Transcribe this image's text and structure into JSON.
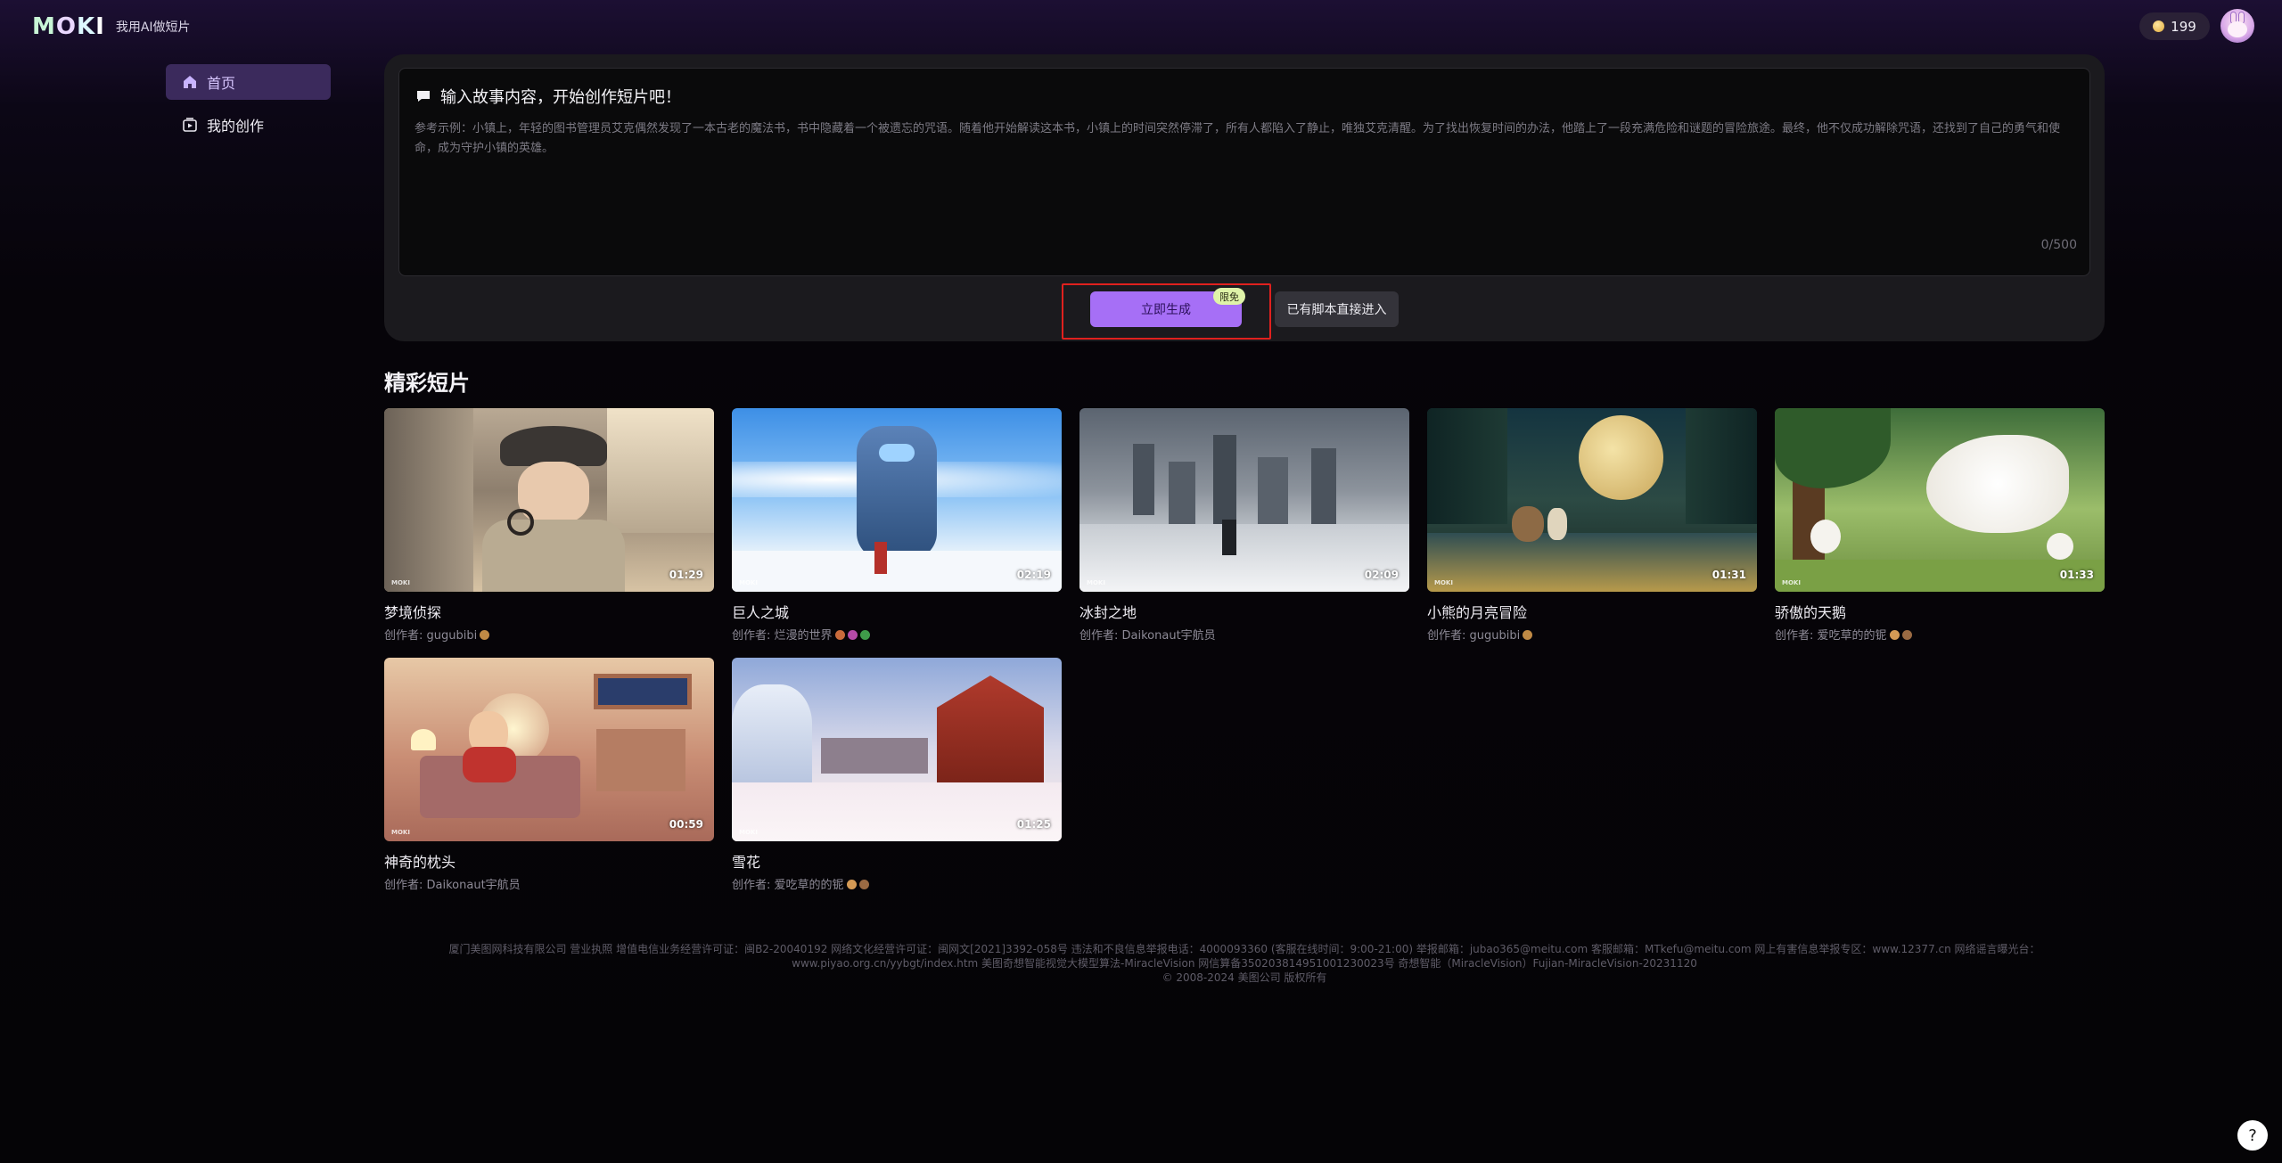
{
  "header": {
    "logo_text": "MOKI",
    "slogan": "我用AI做短片",
    "coins": "199",
    "avatar_icon": "bunny-avatar"
  },
  "sidebar": {
    "items": [
      {
        "label": "首页",
        "icon": "home-icon",
        "active": true
      },
      {
        "label": "我的创作",
        "icon": "my-works-icon",
        "active": false
      }
    ]
  },
  "composer": {
    "title": "输入故事内容，开始创作短片吧！",
    "example": "参考示例：小镇上，年轻的图书管理员艾克偶然发现了一本古老的魔法书，书中隐藏着一个被遗忘的咒语。随着他开始解读这本书，小镇上的时间突然停滞了，所有人都陷入了静止，唯独艾克清醒。为了找出恢复时间的办法，他踏上了一段充满危险和谜题的冒险旅途。最终，他不仅成功解除咒语，还找到了自己的勇气和使命，成为守护小镇的英雄。",
    "counter": "0/500",
    "generate_label": "立即生成",
    "free_badge": "限免",
    "script_label": "已有脚本直接进入"
  },
  "gallery": {
    "title": "精彩短片",
    "cards": [
      {
        "title": "梦境侦探",
        "author": "创作者: gugubibi",
        "duration": "01:29",
        "watermark": "MOKI"
      },
      {
        "title": "巨人之城",
        "author": "创作者: 烂漫的世界",
        "duration": "02:19",
        "watermark": "MOKI"
      },
      {
        "title": "冰封之地",
        "author": "创作者: Daikonaut宇航员",
        "duration": "02:09",
        "watermark": "MOKI"
      },
      {
        "title": "小熊的月亮冒险",
        "author": "创作者: gugubibi",
        "duration": "01:31",
        "watermark": "MOKI"
      },
      {
        "title": "骄傲的天鹅",
        "author": "创作者: 爱吃草的的铌",
        "duration": "01:33",
        "watermark": "MOKI"
      },
      {
        "title": "神奇的枕头",
        "author": "创作者: Daikonaut宇航员",
        "duration": "00:59",
        "watermark": "MOKI"
      },
      {
        "title": "雪花",
        "author": "创作者: 爱吃草的的铌",
        "duration": "01:25",
        "watermark": "MOKI"
      }
    ]
  },
  "footer": {
    "line1": "厦门美图网科技有限公司 营业执照 增值电信业务经营许可证：闽B2-20040192 网络文化经营许可证：闽网文[2021]3392-058号 违法和不良信息举报电话：4000093360 (客服在线时间：9:00-21:00) 举报邮箱：jubao365@meitu.com 客服邮箱：MTkefu@meitu.com 网上有害信息举报专区：www.12377.cn 网络谣言曝光台：",
    "line2": "www.piyao.org.cn/yybgt/index.htm 美图奇想智能视觉大模型算法-MiracleVision 网信算备350203814951001230023号 奇想智能（MiracleVision）Fujian-MiracleVision-20231120",
    "line3": "© 2008-2024 美图公司 版权所有"
  },
  "help": {
    "label": "?"
  },
  "colors": {
    "accent": "#a66ff6",
    "highlight_border": "#e0201e",
    "sidebar_active": "#3b2a5c",
    "panel": "#1b1a1e"
  }
}
